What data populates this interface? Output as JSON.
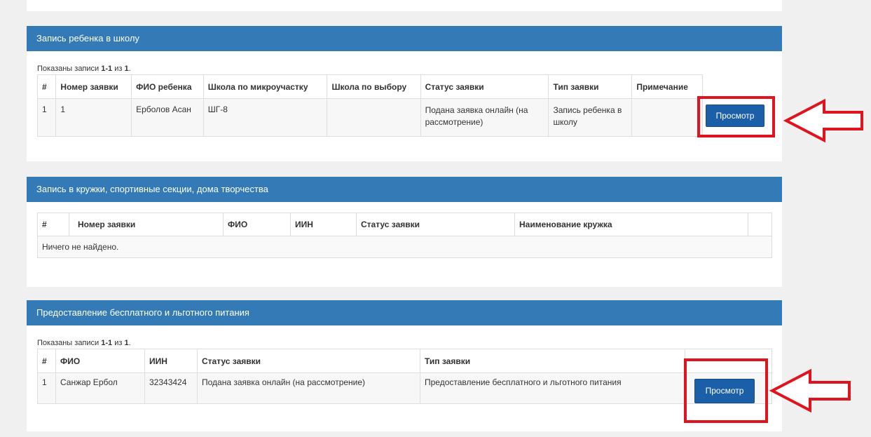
{
  "school": {
    "title": "Запись ребенка в школу",
    "summary_prefix": "Показаны записи ",
    "summary_range": "1-1",
    "summary_mid": " из ",
    "summary_total": "1",
    "summary_suffix": ".",
    "columns": [
      "#",
      "Номер заявки",
      "ФИО ребенка",
      "Школа по микроучастку",
      "Школа по выбору",
      "Статус заявки",
      "Тип заявки",
      "Примечание",
      ""
    ],
    "row": {
      "num": "1",
      "number": "1",
      "child": "Ерболов Асан",
      "micro_school": "ШГ-8",
      "choice_school": "",
      "status": "Подана заявка онлайн (на рассмотрение)",
      "type": "Запись ребенка в школу",
      "note": "",
      "button": "Просмотр"
    }
  },
  "clubs": {
    "title": "Запись в кружки, спортивные секции, дома творчества",
    "columns": [
      "#",
      "Номер заявки",
      "ФИО",
      "ИИН",
      "Статус заявки",
      "Наименование кружка",
      ""
    ],
    "empty_text": "Ничего не найдено."
  },
  "meals": {
    "title": "Предоставление бесплатного и льготного питания",
    "summary_prefix": "Показаны записи ",
    "summary_range": "1-1",
    "summary_mid": " из ",
    "summary_total": "1",
    "summary_suffix": ".",
    "columns": [
      "#",
      "ФИО",
      "ИИН",
      "Статус заявки",
      "Тип заявки",
      ""
    ],
    "row": {
      "num": "1",
      "name": "Санжар Ербол",
      "iin": "32343424",
      "status": "Подана заявка онлайн (на рассмотрение)",
      "type": "Предоставление бесплатного и льготного питания",
      "button": "Просмотр"
    }
  },
  "colors": {
    "header": "#337ab7",
    "button": "#1a5fa8",
    "highlight": "#e0141e"
  }
}
